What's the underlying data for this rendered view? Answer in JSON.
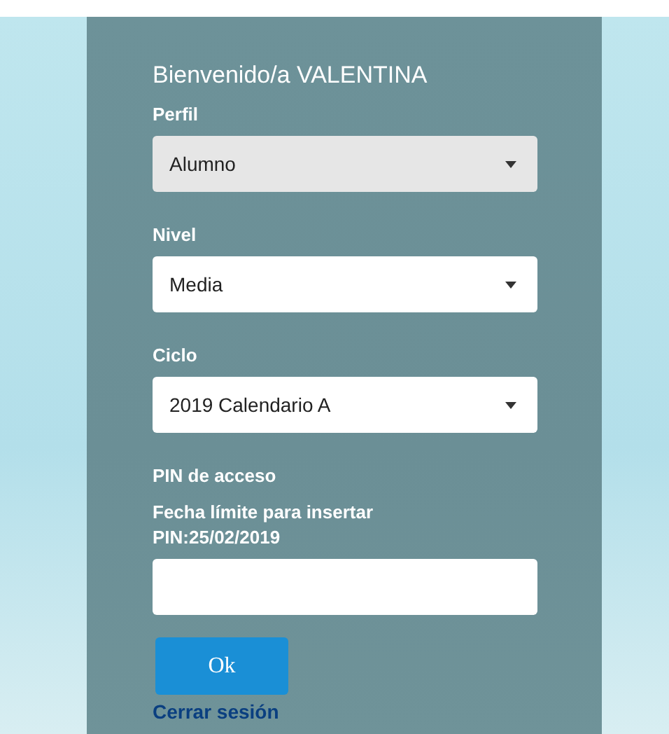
{
  "title": "Bienvenido/a VALENTINA",
  "selects": [
    {
      "label": "Perfil",
      "value": "Alumno",
      "disabled": true
    },
    {
      "label": "Nivel",
      "value": "Media",
      "disabled": false
    },
    {
      "label": "Ciclo",
      "value": "2019 Calendario A",
      "disabled": false
    }
  ],
  "pin": {
    "label": "PIN de acceso",
    "deadline": "Fecha límite para insertar PIN:25/02/2019"
  },
  "button": "Ok",
  "logout_link": "Cerrar sesión"
}
